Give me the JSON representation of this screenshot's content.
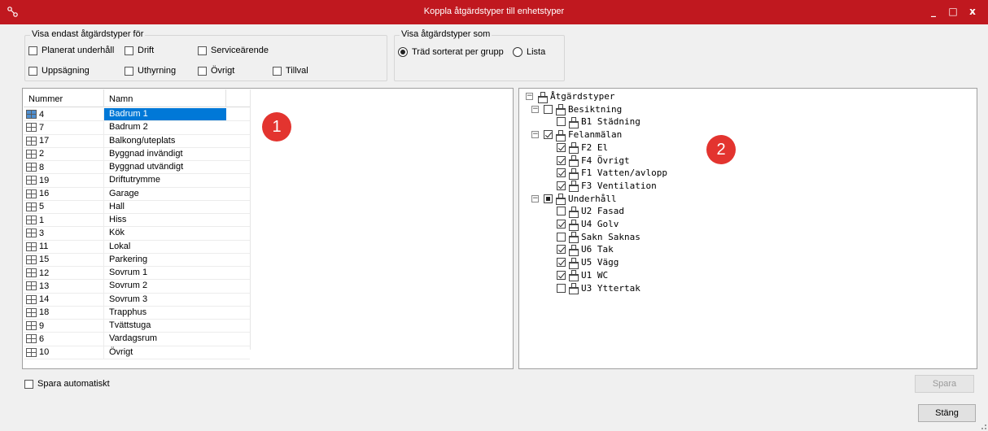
{
  "window": {
    "title": "Koppla åtgärdstyper till enhetstyper",
    "minimize_label": "_",
    "maximize_label": "□",
    "close_label": "x",
    "accent_color": "#c0181f"
  },
  "filter_group": {
    "legend": "Visa endast åtgärdstyper för",
    "options": [
      {
        "label": "Planerat underhåll",
        "checked": false
      },
      {
        "label": "Drift",
        "checked": false
      },
      {
        "label": "Serviceärende",
        "checked": false
      },
      {
        "label": "Uppsägning",
        "checked": false
      },
      {
        "label": "Uthyrning",
        "checked": false
      },
      {
        "label": "Övrigt",
        "checked": false
      },
      {
        "label": "Tillval",
        "checked": false
      }
    ]
  },
  "view_group": {
    "legend": "Visa åtgärdstyper som",
    "options": [
      {
        "label": "Träd sorterat per grupp",
        "selected": true
      },
      {
        "label": "Lista",
        "selected": false
      }
    ]
  },
  "unit_grid": {
    "headers": {
      "number": "Nummer",
      "name": "Namn"
    },
    "rows": [
      {
        "number": "4",
        "name": "Badrum 1",
        "selected": true
      },
      {
        "number": "7",
        "name": "Badrum 2"
      },
      {
        "number": "17",
        "name": "Balkong/uteplats"
      },
      {
        "number": "2",
        "name": "Byggnad invändigt"
      },
      {
        "number": "8",
        "name": "Byggnad utvändigt"
      },
      {
        "number": "19",
        "name": "Driftutrymme"
      },
      {
        "number": "16",
        "name": "Garage"
      },
      {
        "number": "5",
        "name": "Hall"
      },
      {
        "number": "1",
        "name": "Hiss"
      },
      {
        "number": "3",
        "name": "Kök"
      },
      {
        "number": "11",
        "name": "Lokal"
      },
      {
        "number": "15",
        "name": "Parkering"
      },
      {
        "number": "12",
        "name": "Sovrum 1"
      },
      {
        "number": "13",
        "name": "Sovrum 2"
      },
      {
        "number": "14",
        "name": "Sovrum 3"
      },
      {
        "number": "18",
        "name": "Trapphus"
      },
      {
        "number": "9",
        "name": "Tvättstuga"
      },
      {
        "number": "6",
        "name": "Vardagsrum"
      },
      {
        "number": "10",
        "name": "Övrigt"
      }
    ]
  },
  "badges": {
    "left": "1",
    "right": "2"
  },
  "action_tree": {
    "root": "Åtgärdstyper",
    "groups": [
      {
        "label": "Besiktning",
        "state": "unchecked",
        "children": [
          {
            "label": "B1 Städning",
            "checked": false
          }
        ]
      },
      {
        "label": "Felanmälan",
        "state": "checked",
        "children": [
          {
            "label": "F2 El",
            "checked": true
          },
          {
            "label": "F4 Övrigt",
            "checked": true
          },
          {
            "label": "F1 Vatten/avlopp",
            "checked": true
          },
          {
            "label": "F3 Ventilation",
            "checked": true
          }
        ]
      },
      {
        "label": "Underhåll",
        "state": "partial",
        "children": [
          {
            "label": "U2 Fasad",
            "checked": false
          },
          {
            "label": "U4 Golv",
            "checked": true
          },
          {
            "label": "Sakn Saknas",
            "checked": false
          },
          {
            "label": "U6 Tak",
            "checked": true
          },
          {
            "label": "U5 Vägg",
            "checked": true
          },
          {
            "label": "U1 WC",
            "checked": true
          },
          {
            "label": "U3 Yttertak",
            "checked": false
          }
        ]
      }
    ]
  },
  "footer": {
    "autosave_label": "Spara automatiskt",
    "autosave_checked": false,
    "save_label": "Spara",
    "close_label": "Stäng"
  }
}
